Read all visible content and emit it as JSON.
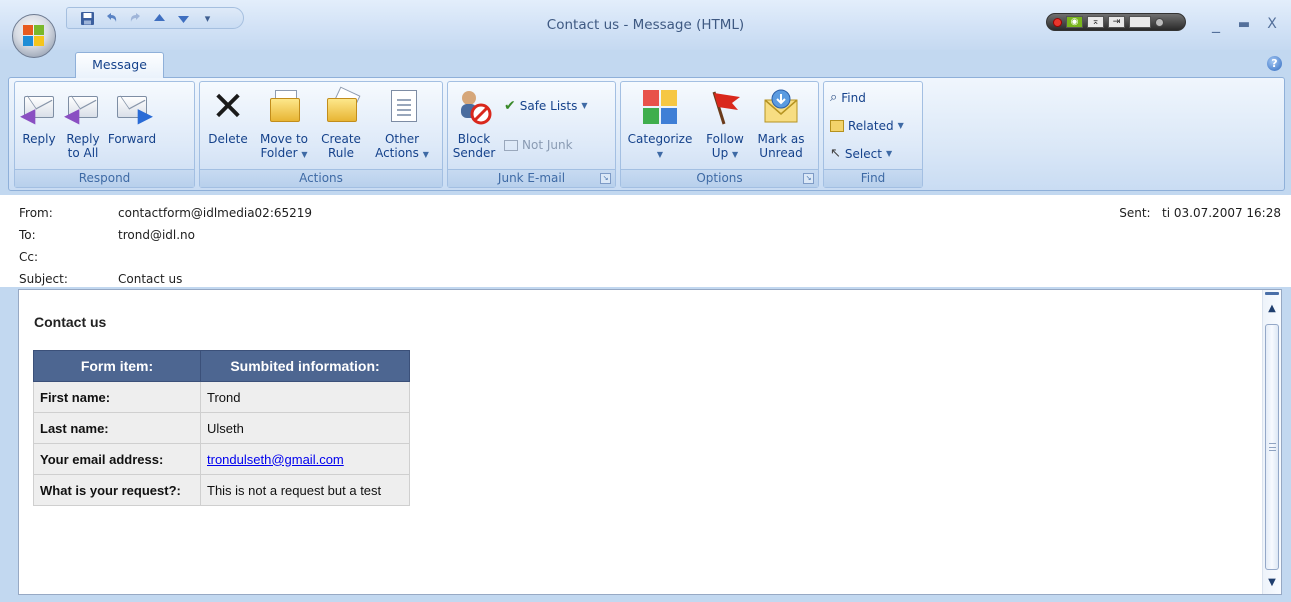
{
  "window": {
    "title": "Contact us - Message (HTML)",
    "minimize": "_",
    "maximize": "□",
    "close": "X"
  },
  "tabs": [
    {
      "label": "Message"
    }
  ],
  "ribbon": {
    "groups": {
      "respond": "Respond",
      "actions": "Actions",
      "junk": "Junk E-mail",
      "options": "Options",
      "find": "Find"
    },
    "buttons": {
      "reply": "Reply",
      "reply_all_1": "Reply",
      "reply_all_2": "to All",
      "forward": "Forward",
      "delete": "Delete",
      "move_to_1": "Move to",
      "move_to_2": "Folder",
      "create_rule_1": "Create",
      "create_rule_2": "Rule",
      "other_actions_1": "Other",
      "other_actions_2": "Actions",
      "block_sender_1": "Block",
      "block_sender_2": "Sender",
      "safe_lists": "Safe Lists",
      "not_junk": "Not Junk",
      "categorize": "Categorize",
      "follow_up_1": "Follow",
      "follow_up_2": "Up",
      "mark_unread_1": "Mark as",
      "mark_unread_2": "Unread",
      "find": "Find",
      "related": "Related",
      "select": "Select"
    }
  },
  "header": {
    "from_label": "From:",
    "from": "contactform@idlmedia02:65219",
    "to_label": "To:",
    "to": "trond@idl.no",
    "cc_label": "Cc:",
    "cc": "",
    "subject_label": "Subject:",
    "subject": "Contact us",
    "sent_label": "Sent:",
    "sent": "ti 03.07.2007 16:28"
  },
  "body": {
    "title": "Contact us",
    "table": {
      "headers": [
        "Form item:",
        "Sumbited information:"
      ],
      "rows": [
        [
          "First name:",
          "Trond"
        ],
        [
          "Last name:",
          "Ulseth"
        ],
        [
          "Your email address:",
          "trondulseth@gmail.com"
        ],
        [
          "What is your request?:",
          "This is not a request but a test"
        ]
      ]
    }
  },
  "colors": {
    "table_header": "#4d6691",
    "ribbon_text": "#15428b",
    "link": "#0000ee"
  }
}
